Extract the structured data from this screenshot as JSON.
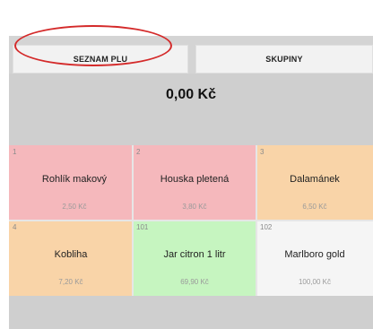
{
  "tabs": {
    "plu_label": "SEZNAM PLU",
    "groups_label": "SKUPINY"
  },
  "total": "0,00 Kč",
  "products": [
    {
      "num": "1",
      "name": "Rohlík makový",
      "price": "2,50 Kč",
      "color": "#f5b8bc"
    },
    {
      "num": "2",
      "name": "Houska pletená",
      "price": "3,80 Kč",
      "color": "#f5b8bc"
    },
    {
      "num": "3",
      "name": "Dalamánek",
      "price": "6,50 Kč",
      "color": "#f9d4a8"
    },
    {
      "num": "4",
      "name": "Kobliha",
      "price": "7,20 Kč",
      "color": "#f9d4a8"
    },
    {
      "num": "101",
      "name": "Jar citron 1 litr",
      "price": "69,90 Kč",
      "color": "#c6f5c0"
    },
    {
      "num": "102",
      "name": "Marlboro gold",
      "price": "100,00 Kč",
      "color": "#f5f5f5"
    }
  ],
  "annotation": {
    "highlight_color": "#d42a2a"
  }
}
